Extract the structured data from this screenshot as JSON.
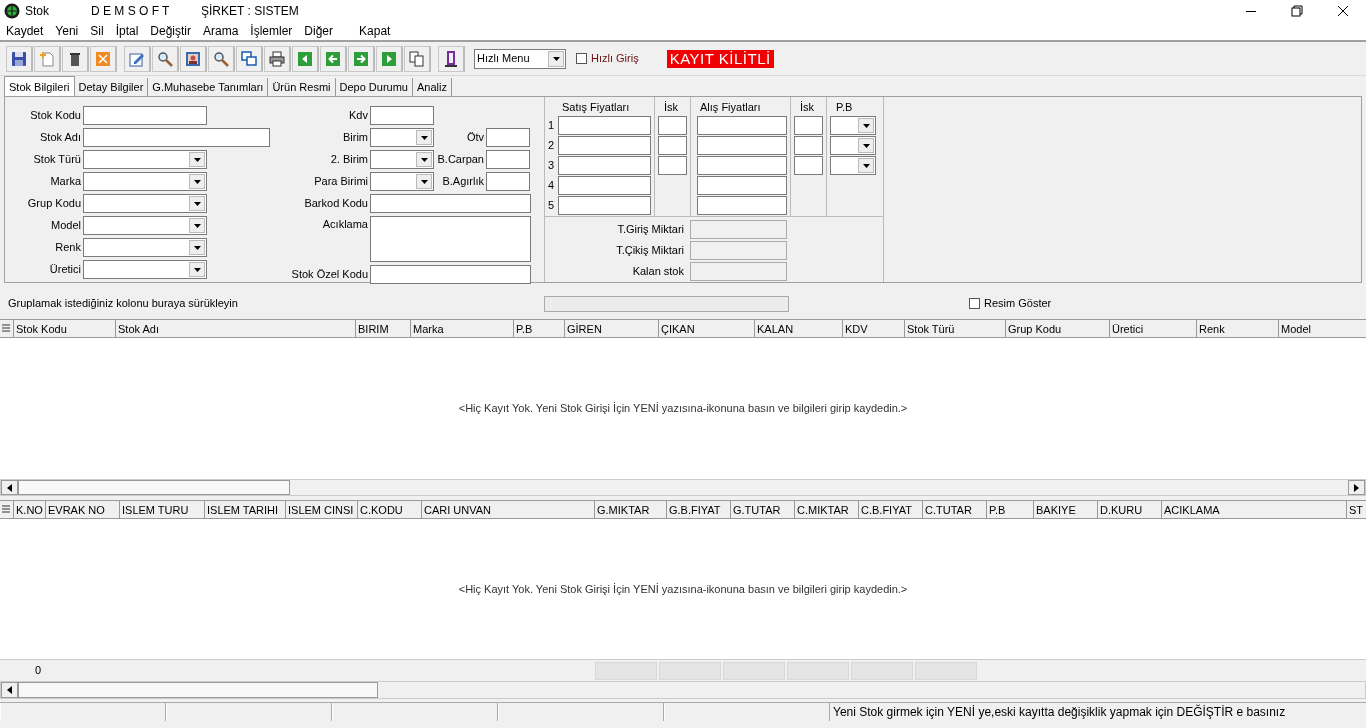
{
  "window": {
    "title": "Stok",
    "brand": "D E M S O F T",
    "company": "ŞİRKET : SISTEM"
  },
  "menu": [
    "Kaydet",
    "Yeni",
    "Sil",
    "İptal",
    "Değiştir",
    "Arama",
    "İşlemler",
    "Diğer",
    "Kapat"
  ],
  "toolbar": {
    "quick_menu": {
      "value": "Hızlı Menu"
    },
    "quick_entry": {
      "label": "Hızlı Giriş",
      "checked": false
    },
    "lock_badge": "KAYIT KİLİTLİ"
  },
  "tabs": [
    {
      "label": "Stok Bilgileri",
      "selected": true
    },
    {
      "label": "Detay Bilgiler",
      "selected": false
    },
    {
      "label": "G.Muhasebe Tanımları",
      "selected": false
    },
    {
      "label": "Ürün Resmi",
      "selected": false
    },
    {
      "label": "Depo Durumu",
      "selected": false
    },
    {
      "label": "Analiz",
      "selected": false
    }
  ],
  "left_fields": [
    {
      "label": "Stok Kodu",
      "kind": "text"
    },
    {
      "label": "Stok Adı",
      "kind": "wide"
    },
    {
      "label": "Stok Türü",
      "kind": "combo"
    },
    {
      "label": "Marka",
      "kind": "combo"
    },
    {
      "label": "Grup Kodu",
      "kind": "combo"
    },
    {
      "label": "Model",
      "kind": "combo"
    },
    {
      "label": "Renk",
      "kind": "combo"
    },
    {
      "label": "Üretici",
      "kind": "combo"
    }
  ],
  "middle_fields": [
    {
      "label": "Kdv",
      "kind": "text"
    },
    {
      "label": "Birim",
      "kind": "combo",
      "side_label": "Ötv"
    },
    {
      "label": "2. Birim",
      "kind": "combo",
      "side_label": "B.Carpan"
    },
    {
      "label": "Para Birimi",
      "kind": "combo",
      "side_label": "B.Agırlık"
    },
    {
      "label": "Barkod Kodu",
      "kind": "wide"
    },
    {
      "label": "Acıklama",
      "kind": "memo"
    },
    {
      "label": "Stok Özel Kodu",
      "kind": "wide"
    }
  ],
  "prices": {
    "headers": [
      "Satış Fiyatları",
      "İsk",
      "Alış Fiyatları",
      "İsk",
      "P.B"
    ],
    "rows": [
      {
        "number": "1",
        "has_discount": true
      },
      {
        "number": "2",
        "has_discount": true
      },
      {
        "number": "3",
        "has_discount": true
      },
      {
        "number": "4",
        "has_discount": false
      },
      {
        "number": "5",
        "has_discount": false
      }
    ]
  },
  "totals": [
    "T.Giriş Miktari",
    "T.Çikiş Miktari",
    "Kalan stok"
  ],
  "group_hint": "Gruplamak istediğiniz kolonu buraya sürükleyin",
  "show_picture": {
    "label": "Resim Göster",
    "checked": false
  },
  "stock_grid": {
    "columns": [
      "Stok Kodu",
      "Stok Adı",
      "BIRIM",
      "Marka",
      "P.B",
      "GİREN",
      "ÇIKAN",
      "KALAN",
      "KDV",
      "Stok Türü",
      "Grup Kodu",
      "Üretici",
      "Renk",
      "Model"
    ],
    "empty_text": "<Hiç Kayıt Yok. Yeni Stok Girişi İçin YENİ yazısına-ikonuna basın ve bilgileri girip kaydedin.>"
  },
  "movement_grid": {
    "columns": [
      "K.NO",
      "EVRAK NO",
      "ISLEM TURU",
      "ISLEM TARIHI",
      "ISLEM CINSI",
      "C.KODU",
      "CARI UNVAN",
      "G.MIKTAR",
      "G.B.FIYAT",
      "G.TUTAR",
      "C.MIKTAR",
      "C.B.FIYAT",
      "C.TUTAR",
      "P.B",
      "BAKIYE",
      "D.KURU",
      "ACIKLAMA",
      "ST"
    ],
    "empty_text": "<Hiç Kayıt Yok. Yeni Stok Girişi İçin YENİ yazısına-ikonuna basın ve bilgileri girip kaydedin.>",
    "footer_count": "0"
  },
  "status_bar": {
    "message": "Yeni Stok girmek için YENİ ye,eski kayıtta değişiklik yapmak için DEĞİŞTİR e basınız"
  }
}
